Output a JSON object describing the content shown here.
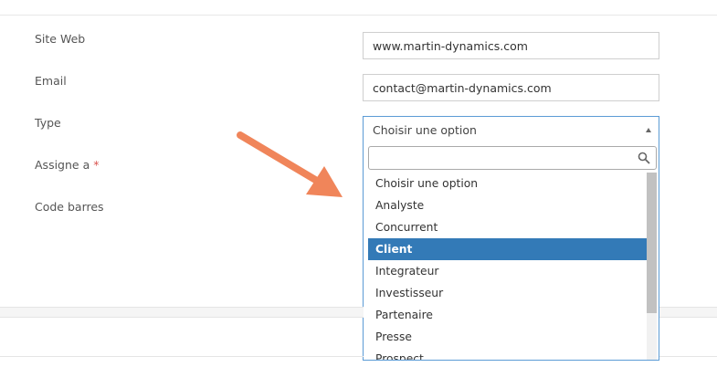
{
  "form": {
    "site_web": {
      "label": "Site Web",
      "value": "www.martin-dynamics.com"
    },
    "email": {
      "label": "Email",
      "value": "contact@martin-dynamics.com"
    },
    "type": {
      "label": "Type",
      "value": "Choisir une option"
    },
    "assigne": {
      "label": "Assigne a",
      "required_mark": "*"
    },
    "code_barres": {
      "label": "Code barres"
    }
  },
  "dropdown": {
    "search_value": "",
    "options": [
      {
        "label": "Choisir une option"
      },
      {
        "label": "Analyste"
      },
      {
        "label": "Concurrent"
      },
      {
        "label": "Client"
      },
      {
        "label": "Integrateur"
      },
      {
        "label": "Investisseur"
      },
      {
        "label": "Partenaire"
      },
      {
        "label": "Presse"
      },
      {
        "label": "Prospect"
      }
    ],
    "highlighted_index": 3,
    "highlight_color": "#337ab7"
  },
  "annotation": {
    "arrow_color": "#f0855a"
  }
}
